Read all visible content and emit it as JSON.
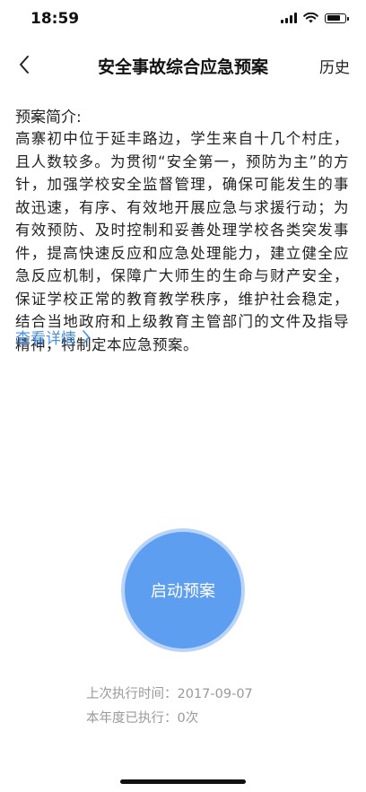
{
  "status_bar": {
    "time": "18:59",
    "battery_level": 0.75,
    "icons": [
      "cellular-signal-icon",
      "wifi-icon",
      "battery-icon"
    ]
  },
  "nav": {
    "title": "安全事故综合应急预案",
    "history_label": "历史",
    "back_icon": "chevron-left-icon"
  },
  "plan": {
    "intro_label": "预案简介:",
    "intro_text": "高寨初中位于延丰路边，学生来自十几个村庄，且人数较多。为贯彻“安全第一，预防为主”的方针，加强学校安全监督管理，确保可能发生的事故迅速，有序、有效地开展应急与求援行动；为有效预防、及时控制和妥善处理学校各类突发事件，提高快速反应和应急处理能力，建立健全应急反应机制，保障广大师生的生命与财产安全，保证学校正常的教育教学秩序，维护社会稳定，结合当地政府和上级教育主管部门的文件及指导精神，特制定本应急预案。",
    "detail_link": "查看详情",
    "detail_icon": "chevron-right-icon"
  },
  "action": {
    "start_label": "启动预案",
    "last_exec_text": "上次执行时间：2017-09-07",
    "year_exec_text": "本年度已执行：0次"
  },
  "colors": {
    "accent": "#4a90e2",
    "button": "#5e9ef1",
    "button_ring": "#b9d4fa",
    "muted": "#9a9a9a"
  }
}
